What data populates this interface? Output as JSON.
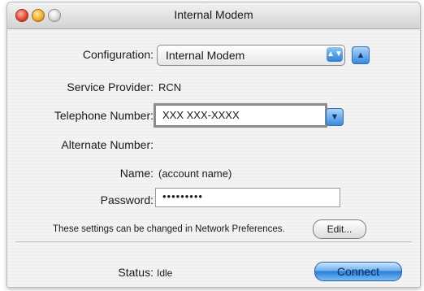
{
  "window": {
    "title": "Internal Modem"
  },
  "form": {
    "configuration": {
      "label": "Configuration:",
      "value": "Internal Modem"
    },
    "service_provider": {
      "label": "Service Provider:",
      "value": "RCN"
    },
    "telephone": {
      "label": "Telephone Number:",
      "value": "XXX XXX-XXXX"
    },
    "alternate": {
      "label": "Alternate Number:",
      "value": ""
    },
    "name": {
      "label": "Name:",
      "value": "(account name)"
    },
    "password": {
      "label": "Password:",
      "value": "•••••••••"
    }
  },
  "hint": {
    "text": "These settings can be changed in Network Preferences.",
    "edit_label": "Edit..."
  },
  "status": {
    "label": "Status:",
    "value": "Idle",
    "connect_label": "Connect"
  },
  "icons": {
    "popup_arrows": "up-down-arrows-icon",
    "expand": "disclosure-up-icon",
    "dropdown": "chevron-down-icon"
  },
  "colors": {
    "accent": "#2f7fd6"
  }
}
